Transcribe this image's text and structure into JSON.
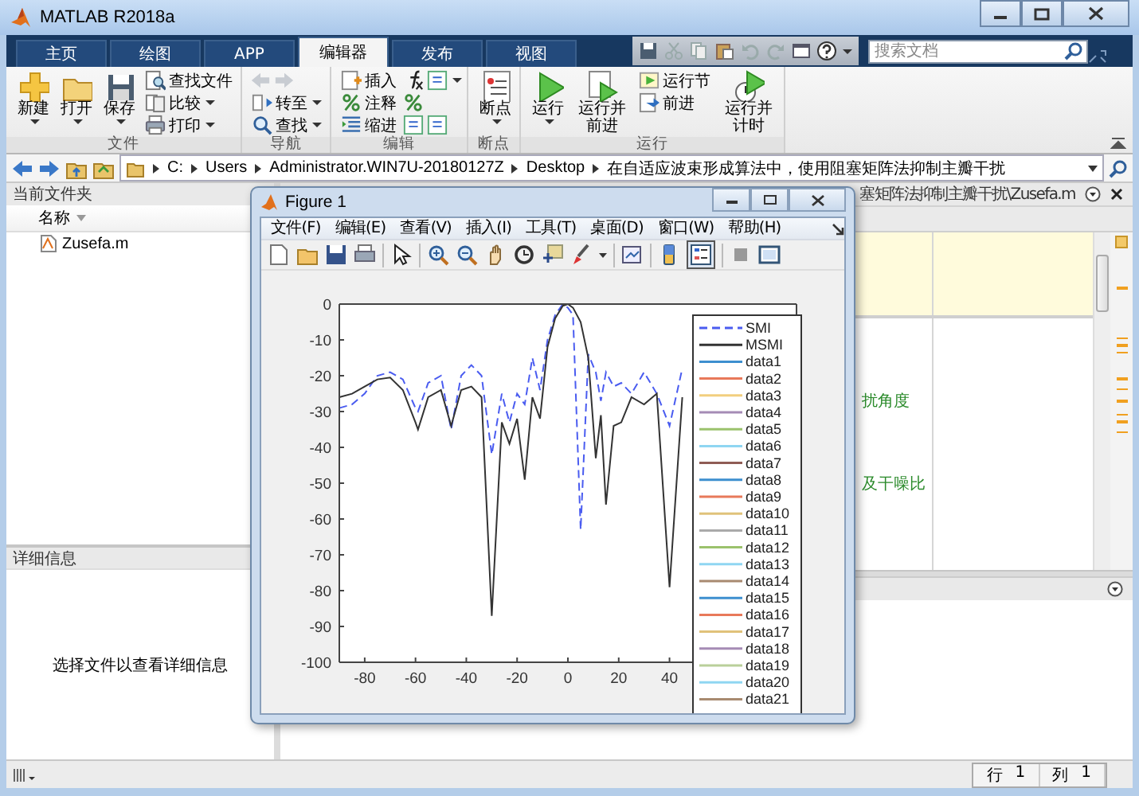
{
  "window": {
    "title": "MATLAB R2018a"
  },
  "tabs": [
    {
      "label": "主页",
      "selected": false
    },
    {
      "label": "绘图",
      "selected": false
    },
    {
      "label": "APP",
      "selected": false
    },
    {
      "label": "编辑器",
      "selected": true
    },
    {
      "label": "发布",
      "selected": false
    },
    {
      "label": "视图",
      "selected": false
    }
  ],
  "search": {
    "placeholder": "搜索文档"
  },
  "ribbon": {
    "groups": [
      {
        "label": "文件",
        "items": [
          {
            "label": "新建",
            "kind": "large",
            "dropdown": true
          },
          {
            "label": "打开",
            "kind": "large",
            "dropdown": true
          },
          {
            "label": "保存",
            "kind": "large",
            "dropdown": true
          },
          {
            "label": "查找文件",
            "kind": "small",
            "dropdown": false
          },
          {
            "label": "比较",
            "kind": "small",
            "dropdown": true
          },
          {
            "label": "打印",
            "kind": "small",
            "dropdown": true
          }
        ]
      },
      {
        "label": "导航",
        "items": [
          {
            "label": "转至",
            "kind": "small",
            "dropdown": true
          },
          {
            "label": "查找",
            "kind": "small",
            "dropdown": true
          }
        ]
      },
      {
        "label": "编辑",
        "items": [
          {
            "label": "插入",
            "kind": "small",
            "dropdown": true
          },
          {
            "label": "注释",
            "kind": "small",
            "dropdown": false
          },
          {
            "label": "缩进",
            "kind": "small",
            "dropdown": false
          }
        ]
      },
      {
        "label": "断点",
        "items": [
          {
            "label": "断点",
            "kind": "large",
            "dropdown": true
          }
        ]
      },
      {
        "label": "运行",
        "items": [
          {
            "label": "运行",
            "kind": "large",
            "dropdown": true
          },
          {
            "label": "运行并前进",
            "kind": "large",
            "dropdown": false
          },
          {
            "label": "运行节",
            "kind": "small",
            "dropdown": false
          },
          {
            "label": "前进",
            "kind": "small",
            "dropdown": false
          },
          {
            "label": "运行并计时",
            "kind": "large",
            "dropdown": false
          }
        ]
      }
    ]
  },
  "address_bar": {
    "segments": [
      "C:",
      "Users",
      "Administrator.WIN7U-20180127Z",
      "Desktop",
      "在自适应波束形成算法中，使用阻塞矩阵法抑制主瓣干扰"
    ]
  },
  "current_folder": {
    "title": "当前文件夹",
    "column": "名称",
    "files": [
      {
        "name": "Zusefa.m",
        "selected": false
      }
    ]
  },
  "details": {
    "title": "详细信息",
    "message": "选择文件以查看详细信息"
  },
  "editor": {
    "title": "塞矩阵法抑制主瓣干扰\\Zusefa.m",
    "lines": [
      "扰角度",
      "及干噪比"
    ]
  },
  "figure": {
    "title": "Figure 1",
    "menu": [
      "文件(F)",
      "编辑(E)",
      "查看(V)",
      "插入(I)",
      "工具(T)",
      "桌面(D)",
      "窗口(W)",
      "帮助(H)"
    ],
    "chart_data": {
      "type": "line",
      "xlim": [
        -90,
        90
      ],
      "ylim": [
        -100,
        0
      ],
      "xticks": [
        -80,
        -60,
        -40,
        -20,
        0,
        20,
        40
      ],
      "yticks": [
        0,
        -10,
        -20,
        -30,
        -40,
        -50,
        -60,
        -70,
        -80,
        -90,
        -100
      ],
      "legend": true,
      "x": [
        -90,
        -85,
        -80,
        -75,
        -70,
        -65,
        -60,
        -59,
        -55,
        -50,
        -46,
        -42,
        -38,
        -34,
        -30,
        -26,
        -23,
        -20,
        -17,
        -14,
        -11,
        -8,
        -5,
        -2,
        0,
        2,
        5,
        8,
        11,
        13,
        15,
        18,
        21,
        25,
        30,
        35,
        40,
        45
      ],
      "series": [
        {
          "name": "SMI",
          "color": "#4a5cf0",
          "line_style": "dashed",
          "values": [
            -29,
            -28,
            -25,
            -20,
            -19,
            -21,
            -29,
            -30,
            -22,
            -20,
            -35,
            -20,
            -17,
            -20,
            -42,
            -25,
            -33,
            -25,
            -28,
            -15,
            -24,
            -10,
            -3,
            0,
            -1,
            -3,
            -63,
            -14,
            -19,
            -27,
            -19,
            -23,
            -22,
            -25,
            -19,
            -25,
            -34,
            -18
          ]
        },
        {
          "name": "MSMI",
          "color": "#333333",
          "line_style": "solid",
          "values": [
            -26,
            -25,
            -23,
            -21,
            -20.5,
            -24,
            -33,
            -35,
            -26,
            -24,
            -34,
            -24,
            -23,
            -26,
            -87,
            -33,
            -39,
            -32,
            -49,
            -26,
            -32,
            -12,
            -4,
            -0.5,
            0,
            -1,
            -5,
            -15,
            -43,
            -31,
            -56,
            -34,
            -33,
            -26,
            -28,
            -25,
            -79,
            -26
          ]
        },
        {
          "name": "data1",
          "color": "#3d8fcf",
          "line_style": "solid",
          "values": [
            null,
            null,
            null,
            null,
            null,
            null,
            null,
            null,
            null,
            null,
            null,
            null,
            null,
            null,
            null,
            null,
            null,
            null,
            null,
            null,
            null,
            null,
            null,
            null,
            null,
            null,
            null,
            null,
            null,
            null,
            null,
            null,
            null,
            null,
            null,
            null,
            null,
            null
          ]
        },
        {
          "name": "data2",
          "color": "#e8795a",
          "line_style": "solid",
          "values": [
            null,
            null,
            null,
            null,
            null,
            null,
            null,
            null,
            null,
            null,
            null,
            null,
            null,
            null,
            null,
            null,
            null,
            null,
            null,
            null,
            null,
            null,
            null,
            null,
            null,
            null,
            null,
            null,
            null,
            null,
            null,
            null,
            null,
            null,
            null,
            null,
            null,
            null
          ]
        },
        {
          "name": "data3",
          "color": "#f2cf7e",
          "line_style": "solid",
          "values": [
            null,
            null,
            null,
            null,
            null,
            null,
            null,
            null,
            null,
            null,
            null,
            null,
            null,
            null,
            null,
            null,
            null,
            null,
            null,
            null,
            null,
            null,
            null,
            null,
            null,
            null,
            null,
            null,
            null,
            null,
            null,
            null,
            null,
            null,
            null,
            null,
            null,
            null
          ]
        },
        {
          "name": "data4",
          "color": "#a58bb5",
          "line_style": "solid",
          "values": [
            null,
            null,
            null,
            null,
            null,
            null,
            null,
            null,
            null,
            null,
            null,
            null,
            null,
            null,
            null,
            null,
            null,
            null,
            null,
            null,
            null,
            null,
            null,
            null,
            null,
            null,
            null,
            null,
            null,
            null,
            null,
            null,
            null,
            null,
            null,
            null,
            null,
            null
          ]
        },
        {
          "name": "data5",
          "color": "#9bc26c",
          "line_style": "solid",
          "values": [
            null,
            null,
            null,
            null,
            null,
            null,
            null,
            null,
            null,
            null,
            null,
            null,
            null,
            null,
            null,
            null,
            null,
            null,
            null,
            null,
            null,
            null,
            null,
            null,
            null,
            null,
            null,
            null,
            null,
            null,
            null,
            null,
            null,
            null,
            null,
            null,
            null,
            null
          ]
        },
        {
          "name": "data6",
          "color": "#8fd6f2",
          "line_style": "solid",
          "values": [
            null,
            null,
            null,
            null,
            null,
            null,
            null,
            null,
            null,
            null,
            null,
            null,
            null,
            null,
            null,
            null,
            null,
            null,
            null,
            null,
            null,
            null,
            null,
            null,
            null,
            null,
            null,
            null,
            null,
            null,
            null,
            null,
            null,
            null,
            null,
            null,
            null,
            null
          ]
        },
        {
          "name": "data7",
          "color": "#8f5c55",
          "line_style": "solid",
          "values": [
            null,
            null,
            null,
            null,
            null,
            null,
            null,
            null,
            null,
            null,
            null,
            null,
            null,
            null,
            null,
            null,
            null,
            null,
            null,
            null,
            null,
            null,
            null,
            null,
            null,
            null,
            null,
            null,
            null,
            null,
            null,
            null,
            null,
            null,
            null,
            null,
            null,
            null
          ]
        },
        {
          "name": "data8",
          "color": "#3d8fcf",
          "line_style": "solid",
          "values": [
            null,
            null,
            null,
            null,
            null,
            null,
            null,
            null,
            null,
            null,
            null,
            null,
            null,
            null,
            null,
            null,
            null,
            null,
            null,
            null,
            null,
            null,
            null,
            null,
            null,
            null,
            null,
            null,
            null,
            null,
            null,
            null,
            null,
            null,
            null,
            null,
            null,
            null
          ]
        },
        {
          "name": "data9",
          "color": "#e8795a",
          "line_style": "solid",
          "values": [
            null,
            null,
            null,
            null,
            null,
            null,
            null,
            null,
            null,
            null,
            null,
            null,
            null,
            null,
            null,
            null,
            null,
            null,
            null,
            null,
            null,
            null,
            null,
            null,
            null,
            null,
            null,
            null,
            null,
            null,
            null,
            null,
            null,
            null,
            null,
            null,
            null,
            null
          ]
        },
        {
          "name": "data10",
          "color": "#e0c27a",
          "line_style": "solid",
          "values": [
            null,
            null,
            null,
            null,
            null,
            null,
            null,
            null,
            null,
            null,
            null,
            null,
            null,
            null,
            null,
            null,
            null,
            null,
            null,
            null,
            null,
            null,
            null,
            null,
            null,
            null,
            null,
            null,
            null,
            null,
            null,
            null,
            null,
            null,
            null,
            null,
            null,
            null
          ]
        },
        {
          "name": "data11",
          "color": "#aaaaaa",
          "line_style": "solid",
          "values": [
            null,
            null,
            null,
            null,
            null,
            null,
            null,
            null,
            null,
            null,
            null,
            null,
            null,
            null,
            null,
            null,
            null,
            null,
            null,
            null,
            null,
            null,
            null,
            null,
            null,
            null,
            null,
            null,
            null,
            null,
            null,
            null,
            null,
            null,
            null,
            null,
            null,
            null
          ]
        },
        {
          "name": "data12",
          "color": "#9bc26c",
          "line_style": "solid",
          "values": [
            null,
            null,
            null,
            null,
            null,
            null,
            null,
            null,
            null,
            null,
            null,
            null,
            null,
            null,
            null,
            null,
            null,
            null,
            null,
            null,
            null,
            null,
            null,
            null,
            null,
            null,
            null,
            null,
            null,
            null,
            null,
            null,
            null,
            null,
            null,
            null,
            null,
            null
          ]
        },
        {
          "name": "data13",
          "color": "#8fd6f2",
          "line_style": "solid",
          "values": [
            null,
            null,
            null,
            null,
            null,
            null,
            null,
            null,
            null,
            null,
            null,
            null,
            null,
            null,
            null,
            null,
            null,
            null,
            null,
            null,
            null,
            null,
            null,
            null,
            null,
            null,
            null,
            null,
            null,
            null,
            null,
            null,
            null,
            null,
            null,
            null,
            null,
            null
          ]
        },
        {
          "name": "data14",
          "color": "#a88a70",
          "line_style": "solid",
          "values": [
            null,
            null,
            null,
            null,
            null,
            null,
            null,
            null,
            null,
            null,
            null,
            null,
            null,
            null,
            null,
            null,
            null,
            null,
            null,
            null,
            null,
            null,
            null,
            null,
            null,
            null,
            null,
            null,
            null,
            null,
            null,
            null,
            null,
            null,
            null,
            null,
            null,
            null
          ]
        },
        {
          "name": "data15",
          "color": "#3d8fcf",
          "line_style": "solid",
          "values": [
            null,
            null,
            null,
            null,
            null,
            null,
            null,
            null,
            null,
            null,
            null,
            null,
            null,
            null,
            null,
            null,
            null,
            null,
            null,
            null,
            null,
            null,
            null,
            null,
            null,
            null,
            null,
            null,
            null,
            null,
            null,
            null,
            null,
            null,
            null,
            null,
            null,
            null
          ]
        },
        {
          "name": "data16",
          "color": "#e8795a",
          "line_style": "solid",
          "values": [
            null,
            null,
            null,
            null,
            null,
            null,
            null,
            null,
            null,
            null,
            null,
            null,
            null,
            null,
            null,
            null,
            null,
            null,
            null,
            null,
            null,
            null,
            null,
            null,
            null,
            null,
            null,
            null,
            null,
            null,
            null,
            null,
            null,
            null,
            null,
            null,
            null,
            null
          ]
        },
        {
          "name": "data17",
          "color": "#e0c27a",
          "line_style": "solid",
          "values": [
            null,
            null,
            null,
            null,
            null,
            null,
            null,
            null,
            null,
            null,
            null,
            null,
            null,
            null,
            null,
            null,
            null,
            null,
            null,
            null,
            null,
            null,
            null,
            null,
            null,
            null,
            null,
            null,
            null,
            null,
            null,
            null,
            null,
            null,
            null,
            null,
            null,
            null
          ]
        },
        {
          "name": "data18",
          "color": "#a58bb5",
          "line_style": "solid",
          "values": [
            null,
            null,
            null,
            null,
            null,
            null,
            null,
            null,
            null,
            null,
            null,
            null,
            null,
            null,
            null,
            null,
            null,
            null,
            null,
            null,
            null,
            null,
            null,
            null,
            null,
            null,
            null,
            null,
            null,
            null,
            null,
            null,
            null,
            null,
            null,
            null,
            null,
            null
          ]
        },
        {
          "name": "data19",
          "color": "#b9cf9a",
          "line_style": "solid",
          "values": [
            null,
            null,
            null,
            null,
            null,
            null,
            null,
            null,
            null,
            null,
            null,
            null,
            null,
            null,
            null,
            null,
            null,
            null,
            null,
            null,
            null,
            null,
            null,
            null,
            null,
            null,
            null,
            null,
            null,
            null,
            null,
            null,
            null,
            null,
            null,
            null,
            null,
            null
          ]
        },
        {
          "name": "data20",
          "color": "#8fd6f2",
          "line_style": "solid",
          "values": [
            null,
            null,
            null,
            null,
            null,
            null,
            null,
            null,
            null,
            null,
            null,
            null,
            null,
            null,
            null,
            null,
            null,
            null,
            null,
            null,
            null,
            null,
            null,
            null,
            null,
            null,
            null,
            null,
            null,
            null,
            null,
            null,
            null,
            null,
            null,
            null,
            null,
            null
          ]
        },
        {
          "name": "data21",
          "color": "#a88a70",
          "line_style": "solid",
          "values": [
            null,
            null,
            null,
            null,
            null,
            null,
            null,
            null,
            null,
            null,
            null,
            null,
            null,
            null,
            null,
            null,
            null,
            null,
            null,
            null,
            null,
            null,
            null,
            null,
            null,
            null,
            null,
            null,
            null,
            null,
            null,
            null,
            null,
            null,
            null,
            null,
            null,
            null
          ]
        }
      ]
    }
  },
  "status_bar": {
    "fields": [
      {
        "label": "行",
        "value": "1"
      },
      {
        "label": "列",
        "value": "1"
      }
    ]
  }
}
